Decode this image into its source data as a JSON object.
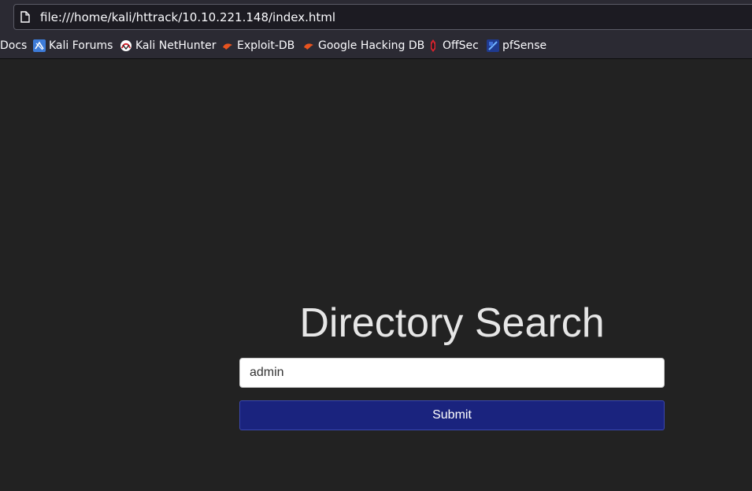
{
  "browser": {
    "url": "file:///home/kali/httrack/10.10.221.148/index.html",
    "bookmarks": [
      {
        "label": "Docs",
        "icon": "docs-icon"
      },
      {
        "label": "Kali Forums",
        "icon": "kali-forums-icon"
      },
      {
        "label": "Kali NetHunter",
        "icon": "kali-nethunter-icon"
      },
      {
        "label": "Exploit-DB",
        "icon": "exploit-db-icon"
      },
      {
        "label": "Google Hacking DB",
        "icon": "google-hacking-db-icon"
      },
      {
        "label": "OffSec",
        "icon": "offsec-icon"
      },
      {
        "label": "pfSense",
        "icon": "pfsense-icon"
      }
    ]
  },
  "page": {
    "title": "Directory Search",
    "search_value": "admin",
    "submit_label": "Submit"
  },
  "colors": {
    "background": "#222222",
    "submit_button": "#1a237e",
    "toolbar": "#2b2a33"
  }
}
